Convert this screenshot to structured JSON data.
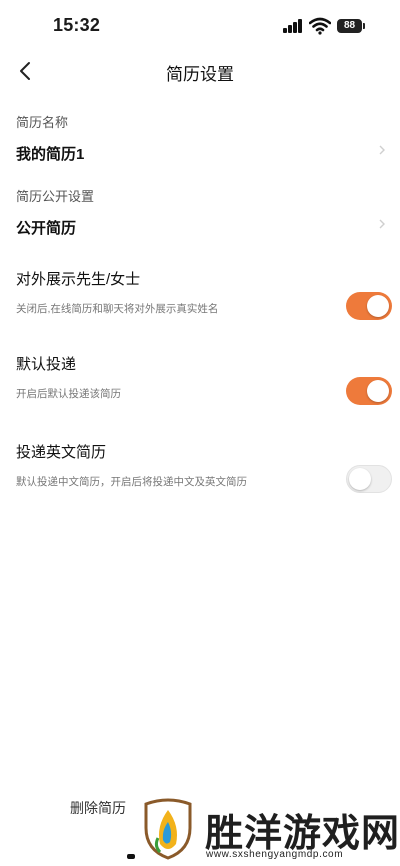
{
  "status_bar": {
    "time": "15:32",
    "battery": "88",
    "signal_icon": "signal-icon",
    "wifi_icon": "wifi-icon"
  },
  "header": {
    "title": "简历设置",
    "back_icon": "chevron-left-icon"
  },
  "resume_name": {
    "label": "简历名称",
    "value": "我的简历1"
  },
  "resume_visibility": {
    "label": "简历公开设置",
    "value": "公开简历"
  },
  "toggles": [
    {
      "title": "对外展示先生/女士",
      "description": "关闭后,在线简历和聊天将对外展示真实姓名",
      "on": true
    },
    {
      "title": "默认投递",
      "description": "开启后默认投递该简历",
      "on": true
    },
    {
      "title": "投递英文简历",
      "description": "默认投递中文简历，开启后将投递中文及英文简历",
      "on": false
    }
  ],
  "delete_label": "删除简历",
  "watermark": {
    "text": "胜洋游戏网",
    "url": "www.sxshengyangmdp.com"
  },
  "colors": {
    "accent": "#ee7a3b",
    "switch_off": "#f0f0f0"
  }
}
